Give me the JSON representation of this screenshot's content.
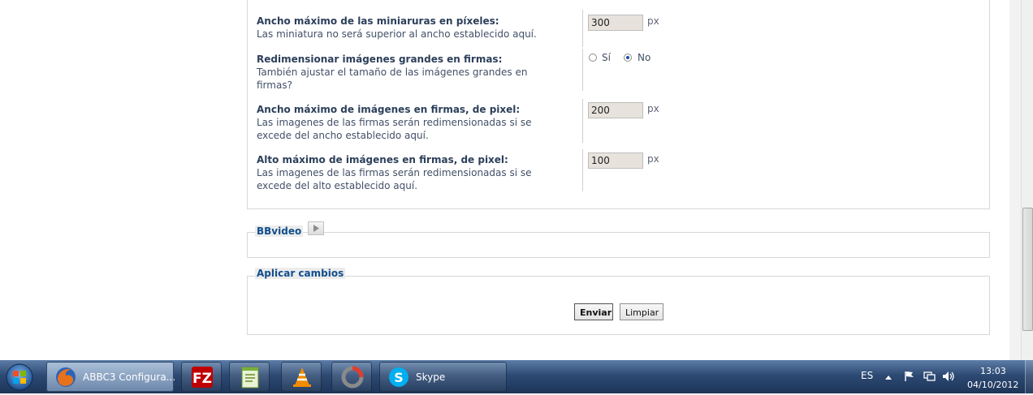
{
  "settings_rows": [
    {
      "title": "Ancho máximo de las miniaruras en píxeles:",
      "description": "Las miniatura no será superior al ancho establecido aquí.",
      "value": "300",
      "unit": "px"
    },
    {
      "title": "Redimensionar imágenes grandes en firmas:",
      "description": "También ajustar el tamaño de las imágenes grandes en firmas?",
      "options": [
        "Sí",
        "No"
      ],
      "selected": "No"
    },
    {
      "title": "Ancho máximo de imágenes en firmas, de pixel:",
      "description": "Las imagenes de las firmas serán redimensionadas si se excede del ancho establecido aquí.",
      "value": "200",
      "unit": "px"
    },
    {
      "title": "Alto máximo de imágenes en firmas, de pixel:",
      "description": "Las imagenes de las firmas serán redimensionadas si se excede del alto establecido aquí.",
      "value": "100",
      "unit": "px"
    }
  ],
  "bbvideo_section": {
    "legend": "BBvideo",
    "icon": "play-icon"
  },
  "apply_section": {
    "legend": "Aplicar cambios",
    "submit_label": "Enviar",
    "reset_label": "Limpiar"
  },
  "taskbar": {
    "apps": [
      {
        "name": "firefox",
        "label": "ABBC3 Configura...",
        "active": true
      },
      {
        "name": "filezilla",
        "label": ""
      },
      {
        "name": "notepadpp",
        "label": ""
      },
      {
        "name": "vlc",
        "label": ""
      },
      {
        "name": "ccleaner",
        "label": ""
      },
      {
        "name": "skype",
        "label": "Skype"
      }
    ],
    "language": "ES",
    "time": "13:03",
    "date": "04/10/2012"
  }
}
